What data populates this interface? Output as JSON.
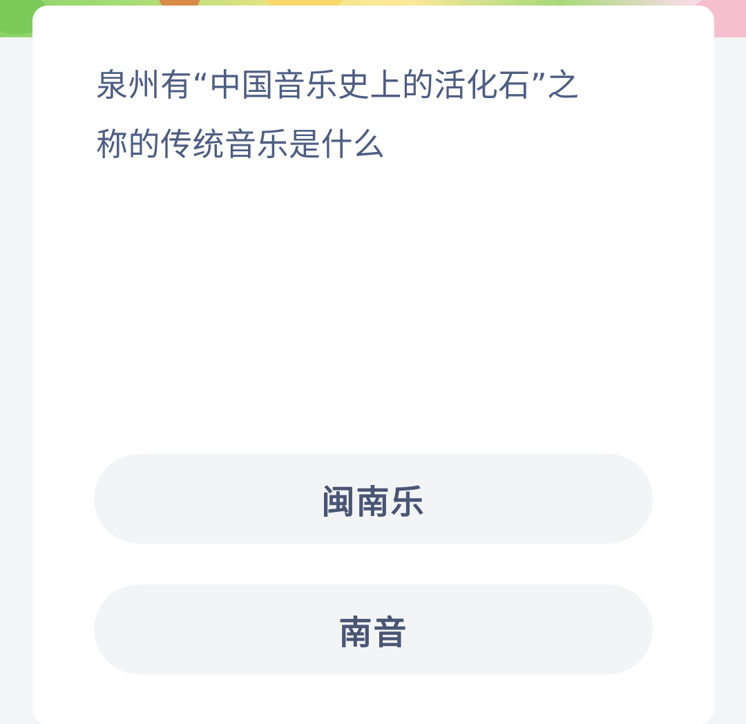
{
  "question": {
    "line1": "泉州有“中国音乐史上的活化石”之",
    "line2": "称的传统音乐是什么"
  },
  "options": [
    {
      "label": "闽南乐"
    },
    {
      "label": "南音"
    }
  ],
  "colors": {
    "page_background": "#f4f5f6",
    "card_background": "#ffffff",
    "question_text": "#4e5d80",
    "option_background": "#f3f4f6",
    "option_text": "#4a5573"
  }
}
